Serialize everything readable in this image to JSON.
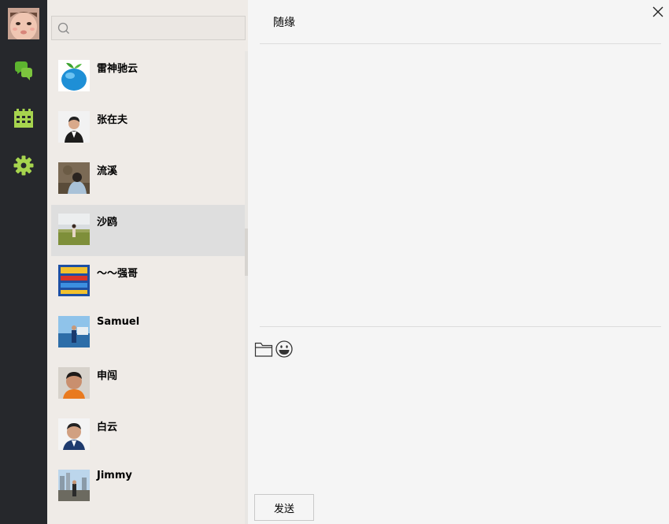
{
  "nav": {
    "avatar_icon": "baby-avatar",
    "items": [
      {
        "name": "chat-icon",
        "color": "#5db42f"
      },
      {
        "name": "calendar-icon",
        "color": "#a6d44e"
      },
      {
        "name": "gear-icon",
        "color": "#a6d44e"
      }
    ]
  },
  "search": {
    "value": "",
    "placeholder": ""
  },
  "contacts": [
    {
      "name": "雷神驰云",
      "avatar": "blue-apple"
    },
    {
      "name": "张在夫",
      "avatar": "man-in-suit"
    },
    {
      "name": "流溪",
      "avatar": "person-outdoors"
    },
    {
      "name": "沙鸥",
      "avatar": "person-in-field",
      "selected": true
    },
    {
      "name": "～～强哥",
      "avatar": "blue-poster"
    },
    {
      "name": "Samuel",
      "avatar": "man-by-sea"
    },
    {
      "name": "申闯",
      "avatar": "man-portrait"
    },
    {
      "name": "白云",
      "avatar": "man-portrait-2"
    },
    {
      "name": "Jimmy",
      "avatar": "man-on-bridge"
    }
  ],
  "chat": {
    "title": "随缘",
    "input_value": "",
    "send_label": "发送",
    "tools": [
      "folder-icon",
      "emoji-icon"
    ]
  },
  "colors": {
    "nav_bg": "#26282c",
    "list_bg": "#efebe7",
    "selected_row": "#dedede",
    "chat_bg": "#f5f5f5"
  }
}
